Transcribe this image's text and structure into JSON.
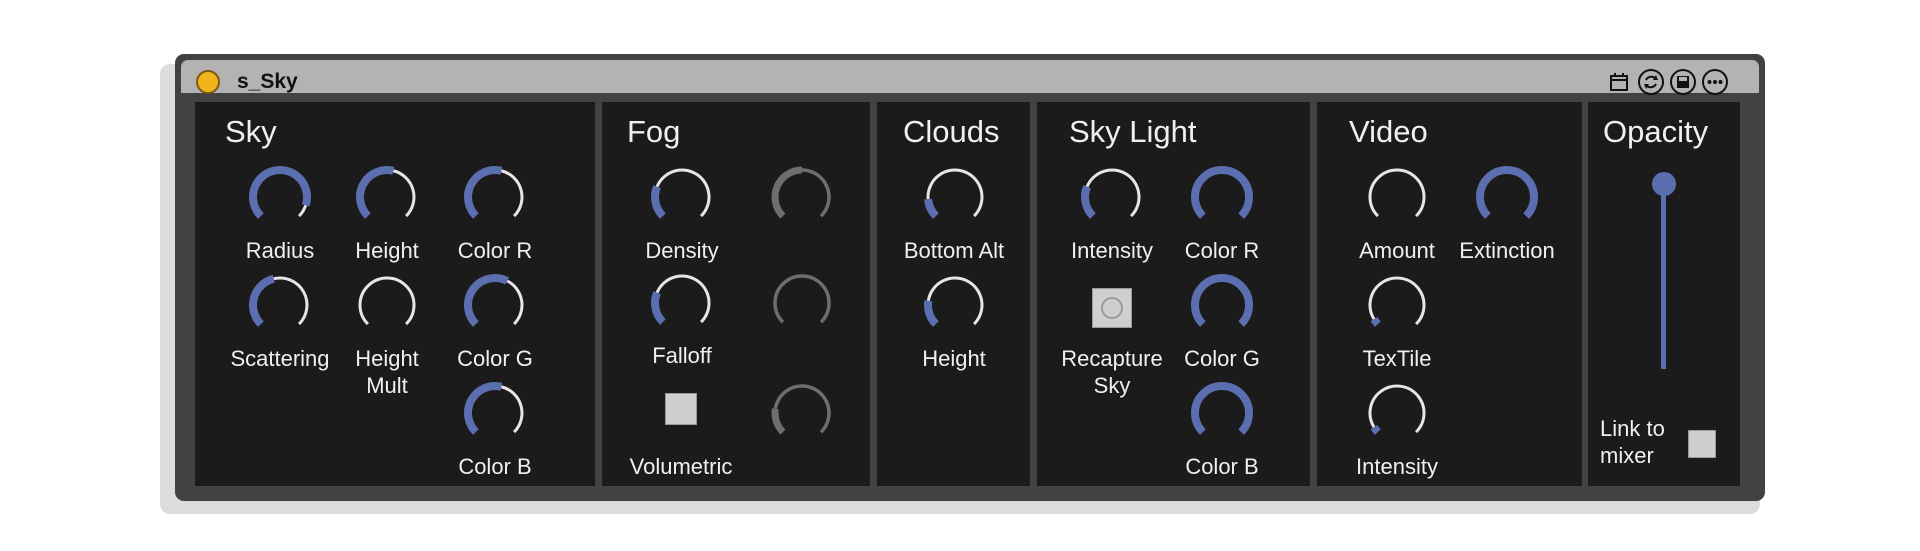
{
  "device": {
    "title": "s_Sky",
    "icons": [
      "clip-icon",
      "refresh-icon",
      "save-icon",
      "more-icon"
    ]
  },
  "colors": {
    "accent": "#5b6fb0",
    "panel": "#1b1b1b",
    "frame": "#424242",
    "titlebar": "#b3b3b3",
    "power": "#f2b21c",
    "inactive_knob": "#e6e6e6",
    "dimmed_knob": "#6e6e6e"
  },
  "sky": {
    "title": "Sky",
    "knobs": [
      {
        "label": "Radius",
        "value": 0.9
      },
      {
        "label": "Height",
        "value": 0.55
      },
      {
        "label": "Color R",
        "value": 0.55
      },
      {
        "label": "Scattering",
        "value": 0.45
      },
      {
        "label": "Height\nMult",
        "value": 0.0
      },
      {
        "label": "Color G",
        "value": 0.6
      },
      {
        "label": "Color B",
        "value": 0.55
      }
    ]
  },
  "fog": {
    "title": "Fog",
    "knobs": [
      {
        "label": "Density",
        "value": 0.25
      },
      {
        "label": "Falloff",
        "value": 0.25
      }
    ],
    "volumetric_label": "Volumetric",
    "dimmed_knobs": [
      {
        "value": 0.5
      },
      {
        "value": 0.0
      },
      {
        "value": 0.2
      }
    ]
  },
  "clouds": {
    "title": "Clouds",
    "knobs": [
      {
        "label": "Bottom Alt",
        "value": 0.15
      },
      {
        "label": "Height",
        "value": 0.2
      }
    ]
  },
  "sky_light": {
    "title": "Sky Light",
    "knobs": [
      {
        "label": "Intensity",
        "value": 0.25
      },
      {
        "label": "Color R",
        "value": 1.0
      },
      {
        "label": "Color G",
        "value": 1.0
      },
      {
        "label": "Color B",
        "value": 1.0
      }
    ],
    "recapture_label": "Recapture\nSky"
  },
  "video": {
    "title": "Video",
    "knobs": [
      {
        "label": "Amount",
        "value": 0.0
      },
      {
        "label": "Extinction",
        "value": 1.0
      },
      {
        "label": "TexTile",
        "value": 0.05
      },
      {
        "label": "Intensity",
        "value": 0.05
      }
    ]
  },
  "opacity": {
    "title": "Opacity",
    "value": 1.0,
    "link_label": "Link to\nmixer"
  }
}
